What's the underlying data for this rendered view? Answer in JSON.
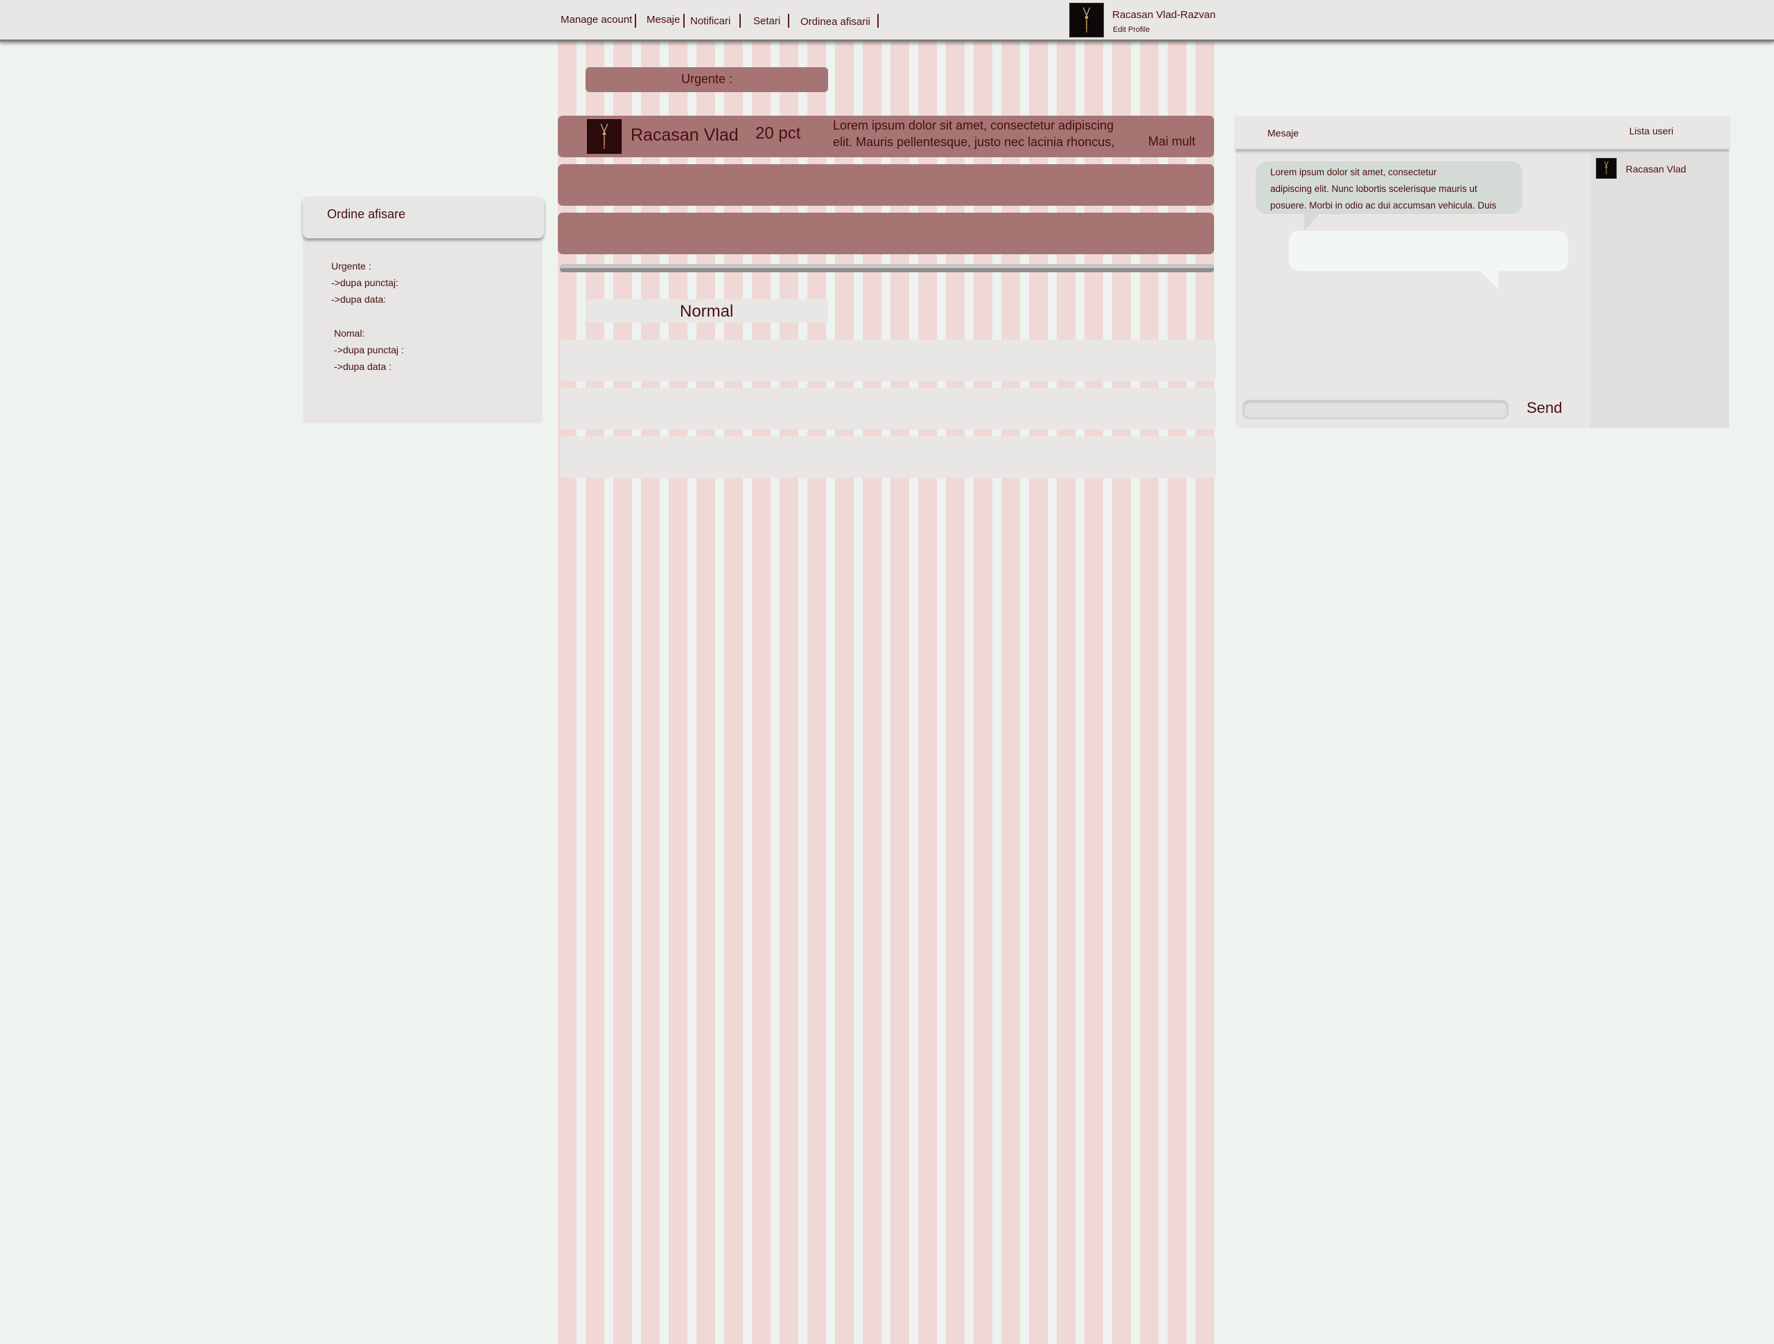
{
  "nav": {
    "items": [
      "Manage acount",
      "Mesaje",
      "Notificari",
      "Setari",
      "Ordinea afisarii"
    ]
  },
  "user": {
    "name": "Racasan Vlad-Razvan",
    "edit_profile": "Edit Profile",
    "avatar_icon": "pendant-icon"
  },
  "sort_panel": {
    "title": "Ordine afisare",
    "lines": [
      "Urgente :",
      "->dupa punctaj:",
      "->dupa data:",
      "Nomal:",
      "->dupa punctaj :",
      "->dupa data :"
    ]
  },
  "urgent": {
    "label": "Urgente :",
    "cards": [
      {
        "name": "Racasan Vlad",
        "score": "20 pct",
        "text": "Lorem ipsum dolor sit amet, consectetur adipiscing elit. Mauris pellentesque, justo nec lacinia rhoncus,",
        "more": "Mai mult"
      },
      {},
      {}
    ]
  },
  "normal": {
    "label": "Normal",
    "rows": [
      {},
      {},
      {}
    ]
  },
  "chat": {
    "tab_messages": "Mesaje",
    "tab_users": "Lista useri",
    "incoming_message": "Lorem ipsum dolor sit amet, consectetur\n adipiscing elit. Nunc lobortis scelerisque mauris ut\nposuere. Morbi in odio ac dui accumsan vehicula. Duis",
    "outgoing_message": "",
    "input_value": "",
    "send_label": "Send",
    "users": [
      {
        "name": "Racasan Vlad"
      }
    ]
  },
  "colors": {
    "background": "#eef3ef",
    "stripe": "#efd8d6",
    "urgent_card": "#a67473",
    "panel": "#e8e7e5",
    "text": "#4a0d12"
  }
}
